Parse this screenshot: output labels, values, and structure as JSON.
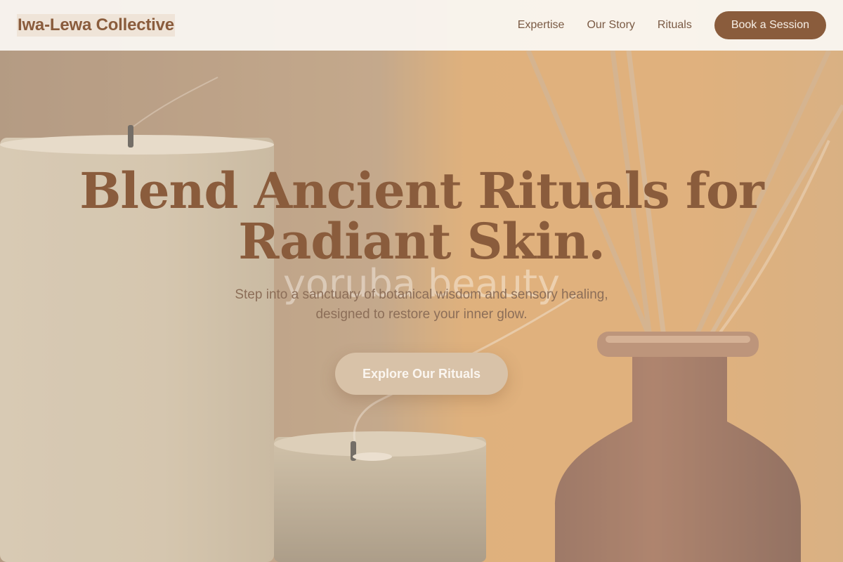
{
  "header": {
    "logo": "Iwa-Lewa Collective",
    "nav": [
      "Expertise",
      "Our Story",
      "Rituals"
    ],
    "book_label": "Book a Session"
  },
  "hero": {
    "headline_line1": "Blend Ancient Rituals for",
    "headline_line2": "Radiant Skin.",
    "watermark": "yoruba beauty",
    "subtitle_line1": "Step into a sanctuary of botanical wisdom and sensory healing,",
    "subtitle_line2": "designed to restore your inner glow.",
    "cta_label": "Explore Our Rituals"
  },
  "colors": {
    "brand": "#8a5c3c",
    "header_bg": "#faf6f2",
    "cta_bg": "#d8c2a8"
  },
  "background_image": {
    "depicts": "candles and reed diffuser with smoke",
    "icons": [
      "candle",
      "reed-diffuser",
      "smoke"
    ]
  }
}
